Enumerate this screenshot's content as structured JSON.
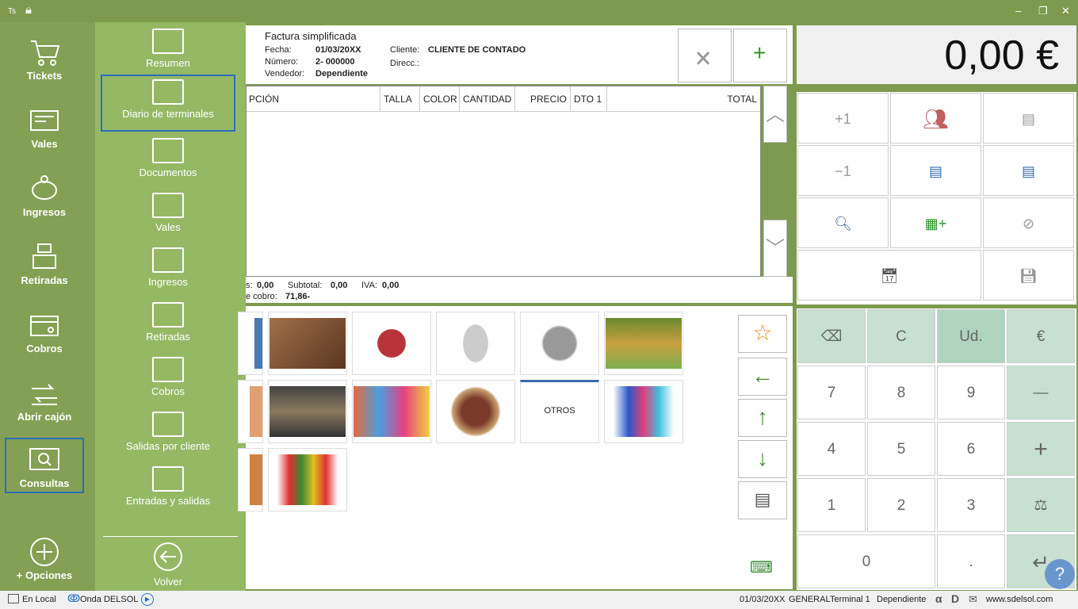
{
  "titlebar": {
    "app_badge": "Ts",
    "minimize": "–",
    "restore": "❐",
    "close": "✕"
  },
  "sidebar": {
    "items": [
      {
        "label": "Tickets"
      },
      {
        "label": "Vales"
      },
      {
        "label": "Ingresos"
      },
      {
        "label": "Retiradas"
      },
      {
        "label": "Cobros"
      },
      {
        "label": "Abrir cajón"
      },
      {
        "label": "Consultas",
        "selected": true
      }
    ],
    "options_label": "+ Opciones"
  },
  "submenu": {
    "items": [
      {
        "label": "Resumen"
      },
      {
        "label": "Diario de terminales",
        "selected": true
      },
      {
        "label": "Documentos"
      },
      {
        "label": "Vales"
      },
      {
        "label": "Ingresos"
      },
      {
        "label": "Retiradas"
      },
      {
        "label": "Cobros"
      },
      {
        "label": "Salidas por cliente"
      },
      {
        "label": "Entradas y salidas"
      }
    ],
    "back_label": "Volver"
  },
  "document": {
    "title": "Factura simplificada",
    "fecha_label": "Fecha:",
    "fecha": "01/03/20XX",
    "numero_label": "Número:",
    "numero": "2- 000000",
    "vendedor_label": "Vendedor:",
    "vendedor": "Dependiente",
    "cliente_label": "Cliente:",
    "cliente": "CLIENTE DE CONTADO",
    "direcc_label": "Direcc.:"
  },
  "table": {
    "columns": [
      "PCIÓN",
      "TALLA",
      "COLOR",
      "CANTIDAD",
      "PRECIO",
      "DTO 1",
      "TOTAL"
    ],
    "rows": []
  },
  "totals": {
    "a_label": "s:",
    "a_value": "0,00",
    "subtotal_label": "Subtotal:",
    "subtotal": "0,00",
    "iva_label": "IVA:",
    "iva": "0,00",
    "cobro_label": "e cobro:",
    "cobro": "71,86-"
  },
  "products": {
    "otros_label": "OTROS"
  },
  "display": {
    "amount": "0,00 €"
  },
  "functions": {
    "plus_one": "+1",
    "minus_one": "−1"
  },
  "keypad": {
    "backspace": "⌫",
    "clear": "C",
    "units": "Ud.",
    "euro": "€",
    "keys": [
      "7",
      "8",
      "9",
      "4",
      "5",
      "6",
      "1",
      "2",
      "3",
      "0",
      "."
    ],
    "minus": "—",
    "plus": "+",
    "enter": "↵"
  },
  "status": {
    "local": "En Local",
    "onda": "Onda DELSOL",
    "date": "01/03/20XX",
    "group": "GENERAL",
    "terminal": "Terminal 1",
    "user": "Dependiente",
    "website": "www.sdelsol.com"
  },
  "colors": {
    "bg_green": "#7d9a4e",
    "sidebar": "#84a054",
    "submenu": "#95b865",
    "keypad_green": "#c7e0d0",
    "selected_border": "#2a6fb8"
  }
}
